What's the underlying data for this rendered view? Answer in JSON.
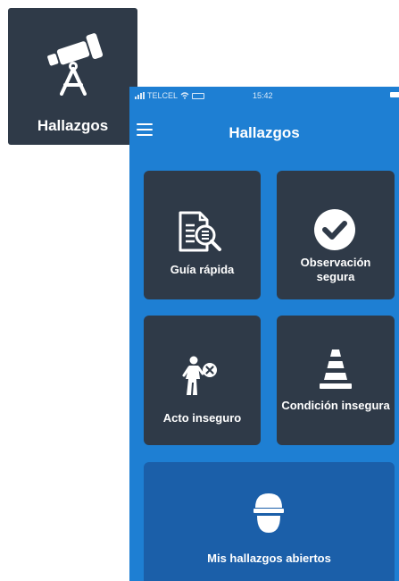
{
  "app_icon": {
    "label": "Hallazgos",
    "icon": "telescope-icon"
  },
  "status_bar": {
    "carrier": "TELCEL",
    "time": "15:42"
  },
  "header": {
    "title": "Hallazgos",
    "menu_icon": "hamburger-menu-icon"
  },
  "tiles": [
    {
      "label": "Guía rápida",
      "icon": "document-search-icon"
    },
    {
      "label": "Observación segura",
      "icon": "checkmark-circle-icon"
    },
    {
      "label": "Acto inseguro",
      "icon": "person-cross-icon"
    },
    {
      "label": "Condición insegura",
      "icon": "traffic-cone-icon"
    },
    {
      "label": "Mis hallazgos abiertos",
      "icon": "hard-hat-icon"
    }
  ],
  "colors": {
    "screen_background": "#1e7fd3",
    "tile_background": "#2f3a48",
    "wide_tile_background": "#1b5fa9",
    "text": "#ffffff"
  }
}
